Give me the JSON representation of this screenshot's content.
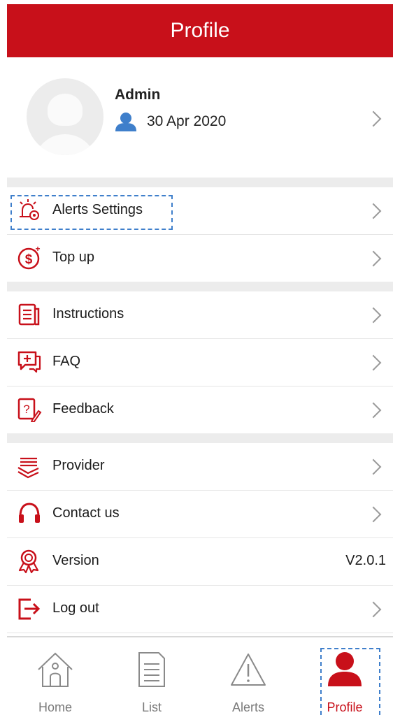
{
  "header": {
    "title": "Profile"
  },
  "profile": {
    "name": "Admin",
    "date": "30 Apr 2020"
  },
  "menu": {
    "alerts_settings": "Alerts Settings",
    "top_up": "Top up",
    "instructions": "Instructions",
    "faq": "FAQ",
    "feedback": "Feedback",
    "provider": "Provider",
    "contact_us": "Contact us",
    "version": "Version",
    "version_value": "V2.0.1",
    "log_out": "Log out"
  },
  "tabs": {
    "home": "Home",
    "list": "List",
    "alerts": "Alerts",
    "profile": "Profile",
    "active": "profile"
  },
  "colors": {
    "brand": "#c8101a",
    "accent_blue": "#3f7fcb",
    "separator": "#ececec"
  }
}
